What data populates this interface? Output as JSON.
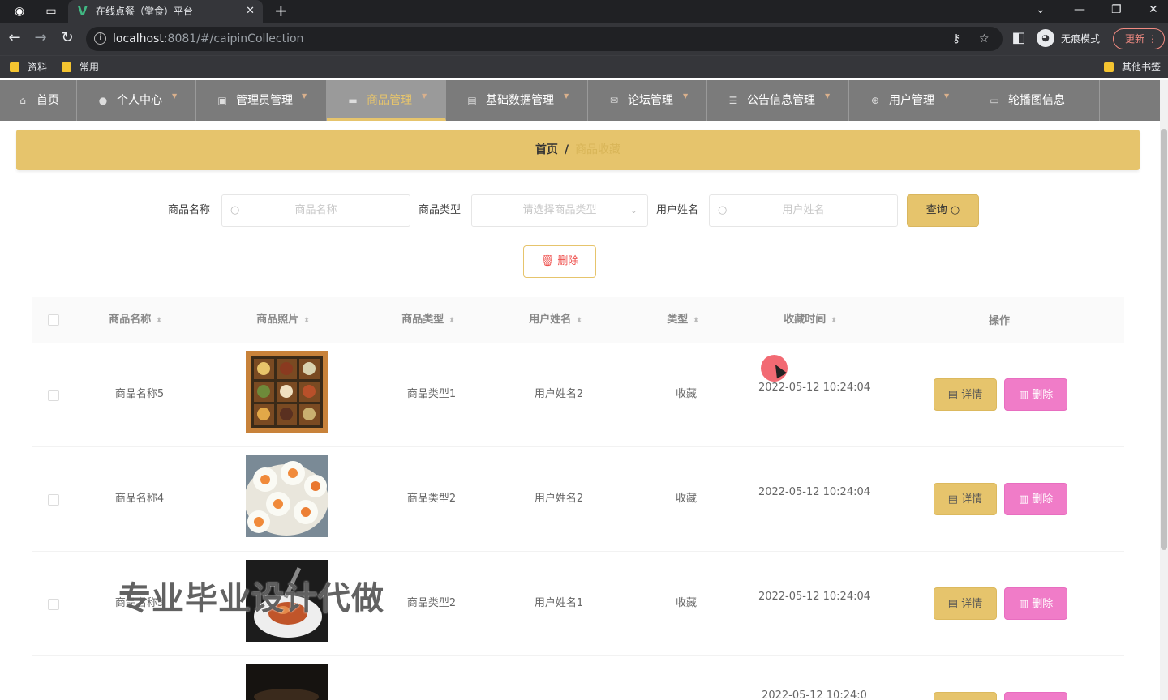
{
  "browser": {
    "tab_title": "在线点餐（堂食）平台",
    "url_host": "localhost",
    "url_rest": ":8081/#/caipinCollection",
    "incognito_label": "无痕模式",
    "update_label": "更新",
    "bookmarks": [
      "资料",
      "常用"
    ],
    "other_bookmarks": "其他书签"
  },
  "nav": {
    "items": [
      {
        "label": "首页",
        "icon": "home-icon"
      },
      {
        "label": "个人中心",
        "icon": "user-icon"
      },
      {
        "label": "管理员管理",
        "icon": "clipboard-icon"
      },
      {
        "label": "商品管理",
        "icon": "monitor-icon"
      },
      {
        "label": "基础数据管理",
        "icon": "image-icon"
      },
      {
        "label": "论坛管理",
        "icon": "mail-icon"
      },
      {
        "label": "公告信息管理",
        "icon": "menu-icon"
      },
      {
        "label": "用户管理",
        "icon": "globe-icon"
      },
      {
        "label": "轮播图信息",
        "icon": "picture-icon"
      }
    ]
  },
  "breadcrumb": {
    "home": "首页",
    "separator": "/",
    "current": "商品收藏"
  },
  "search": {
    "name_label": "商品名称",
    "name_placeholder": "商品名称",
    "type_label": "商品类型",
    "type_placeholder": "请选择商品类型",
    "user_label": "用户姓名",
    "user_placeholder": "用户姓名",
    "query_button": "查询"
  },
  "actions": {
    "delete_button": "删除"
  },
  "table": {
    "headers": [
      "商品名称",
      "商品照片",
      "商品类型",
      "用户姓名",
      "类型",
      "收藏时间",
      "操作"
    ],
    "rows": [
      {
        "name": "商品名称5",
        "type": "商品类型1",
        "user": "用户姓名2",
        "kind": "收藏",
        "time": "2022-05-12 10:24:04",
        "photo": "bento-box"
      },
      {
        "name": "商品名称4",
        "type": "商品类型2",
        "user": "用户姓名2",
        "kind": "收藏",
        "time": "2022-05-12 10:24:04",
        "photo": "sushi-rolls"
      },
      {
        "name": "商品名称3",
        "type": "商品类型2",
        "user": "用户姓名1",
        "kind": "收藏",
        "time": "2022-05-12 10:24:04",
        "photo": "plated-dish"
      },
      {
        "name": "",
        "type": "",
        "user": "",
        "kind": "",
        "time": "2022-05-12 10:24:0",
        "photo": "dark-dish"
      }
    ],
    "detail_button": "详情",
    "delete_button": "删除"
  },
  "watermark": "专业毕业设计代做",
  "colors": {
    "accent": "#e6c46c",
    "nav_bg": "#7b7b7b",
    "delete_pink": "#f07cc8",
    "danger_text": "#ef5350"
  }
}
